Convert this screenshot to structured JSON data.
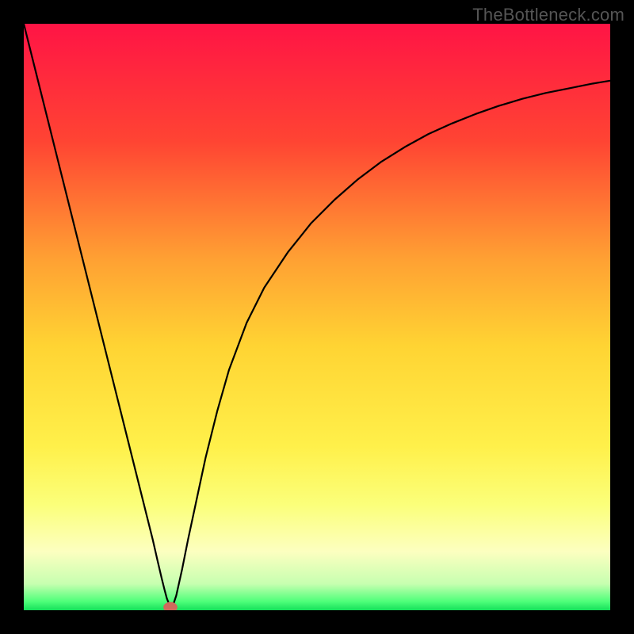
{
  "watermark": "TheBottleneck.com",
  "chart_data": {
    "type": "line",
    "title": "",
    "xlabel": "",
    "ylabel": "",
    "xlim": [
      0,
      100
    ],
    "ylim": [
      0,
      100
    ],
    "grid": false,
    "background_gradient_stops": [
      {
        "pos": 0.0,
        "color": "#ff1445"
      },
      {
        "pos": 0.2,
        "color": "#ff4433"
      },
      {
        "pos": 0.4,
        "color": "#ffa033"
      },
      {
        "pos": 0.55,
        "color": "#ffd433"
      },
      {
        "pos": 0.72,
        "color": "#fff04a"
      },
      {
        "pos": 0.82,
        "color": "#fbff7a"
      },
      {
        "pos": 0.9,
        "color": "#fcffc0"
      },
      {
        "pos": 0.955,
        "color": "#c7ffb0"
      },
      {
        "pos": 0.985,
        "color": "#4fff7a"
      },
      {
        "pos": 1.0,
        "color": "#15e05a"
      }
    ],
    "series": [
      {
        "name": "bottleneck-curve",
        "stroke": "#000000",
        "stroke_width": 2.2,
        "x": [
          0.0,
          2.0,
          4.0,
          6.0,
          8.0,
          10.0,
          12.0,
          14.0,
          16.0,
          18.0,
          19.5,
          21.0,
          22.0,
          22.8,
          23.5,
          24.0,
          24.4,
          24.8,
          25.0,
          25.5,
          26.0,
          27.0,
          28.0,
          29.5,
          31.0,
          33.0,
          35.0,
          38.0,
          41.0,
          45.0,
          49.0,
          53.0,
          57.0,
          61.0,
          65.0,
          69.0,
          73.0,
          77.0,
          81.0,
          85.0,
          89.0,
          93.0,
          97.0,
          100.0
        ],
        "y": [
          100.0,
          92.0,
          84.0,
          76.0,
          68.0,
          60.0,
          52.0,
          44.0,
          36.0,
          28.0,
          22.0,
          16.0,
          12.0,
          8.5,
          5.5,
          3.5,
          2.0,
          1.0,
          0.5,
          1.0,
          2.5,
          7.0,
          12.0,
          19.0,
          26.0,
          34.0,
          41.0,
          49.0,
          55.0,
          61.0,
          66.0,
          70.0,
          73.5,
          76.5,
          79.0,
          81.2,
          83.0,
          84.6,
          86.0,
          87.2,
          88.2,
          89.0,
          89.8,
          90.3
        ]
      }
    ],
    "marker": {
      "name": "minimum-point",
      "x": 25.0,
      "y": 0.5,
      "rx": 1.2,
      "ry": 0.9,
      "fill": "#d06a5c"
    }
  }
}
